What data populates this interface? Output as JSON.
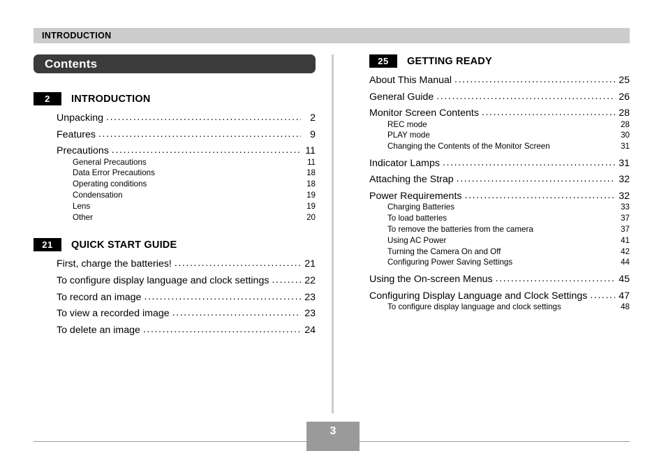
{
  "page": {
    "running_head": "INTRODUCTION",
    "contents_title": "Contents",
    "folio": "3"
  },
  "left_column": {
    "chapters": [
      {
        "number": "2",
        "title": "INTRODUCTION",
        "entries": [
          {
            "label": "Unpacking",
            "page": "2"
          },
          {
            "label": "Features",
            "page": "9"
          },
          {
            "label": "Precautions",
            "page": "11",
            "subentries": [
              {
                "label": "General Precautions",
                "page": "11"
              },
              {
                "label": "Data Error Precautions",
                "page": "18"
              },
              {
                "label": "Operating conditions",
                "page": "18"
              },
              {
                "label": "Condensation",
                "page": "19"
              },
              {
                "label": "Lens",
                "page": "19"
              },
              {
                "label": "Other",
                "page": "20"
              }
            ]
          }
        ]
      },
      {
        "number": "21",
        "title": "QUICK START GUIDE",
        "entries": [
          {
            "label": "First, charge the batteries!",
            "page": "21"
          },
          {
            "label": "To configure display language and clock settings",
            "page": "22"
          },
          {
            "label": "To record an image",
            "page": "23"
          },
          {
            "label": "To view a recorded image",
            "page": "23"
          },
          {
            "label": "To delete an image",
            "page": "24"
          }
        ]
      }
    ]
  },
  "right_column": {
    "chapters": [
      {
        "number": "25",
        "title": "GETTING READY",
        "entries": [
          {
            "label": "About This Manual",
            "page": "25"
          },
          {
            "label": "General Guide",
            "page": "26"
          },
          {
            "label": "Monitor Screen Contents",
            "page": "28",
            "subentries": [
              {
                "label": "REC mode",
                "page": "28"
              },
              {
                "label": "PLAY mode",
                "page": "30"
              },
              {
                "label": "Changing the Contents of the Monitor Screen",
                "page": "31"
              }
            ]
          },
          {
            "label": "Indicator Lamps",
            "page": "31"
          },
          {
            "label": "Attaching the Strap",
            "page": "32"
          },
          {
            "label": "Power Requirements",
            "page": "32",
            "subentries": [
              {
                "label": "Charging Batteries",
                "page": "33"
              },
              {
                "label": "To load batteries",
                "page": "37"
              },
              {
                "label": "To remove the batteries from the camera",
                "page": "37"
              },
              {
                "label": "Using AC Power",
                "page": "41"
              },
              {
                "label": "Turning the Camera On and Off",
                "page": "42"
              },
              {
                "label": "Configuring Power Saving Settings",
                "page": "44"
              }
            ]
          },
          {
            "label": "Using the On-screen Menus",
            "page": "45"
          },
          {
            "label": "Configuring Display Language and Clock Settings",
            "page": "47",
            "subentries": [
              {
                "label": "To configure display language and clock settings",
                "page": "48"
              }
            ]
          }
        ]
      }
    ]
  },
  "style": {
    "running_head_bg": "#cccccc",
    "pill_bg": "#3b3b3b",
    "badge_bg": "#000000",
    "folio_bg": "#9a9a9a",
    "divider": "#cccccc"
  }
}
